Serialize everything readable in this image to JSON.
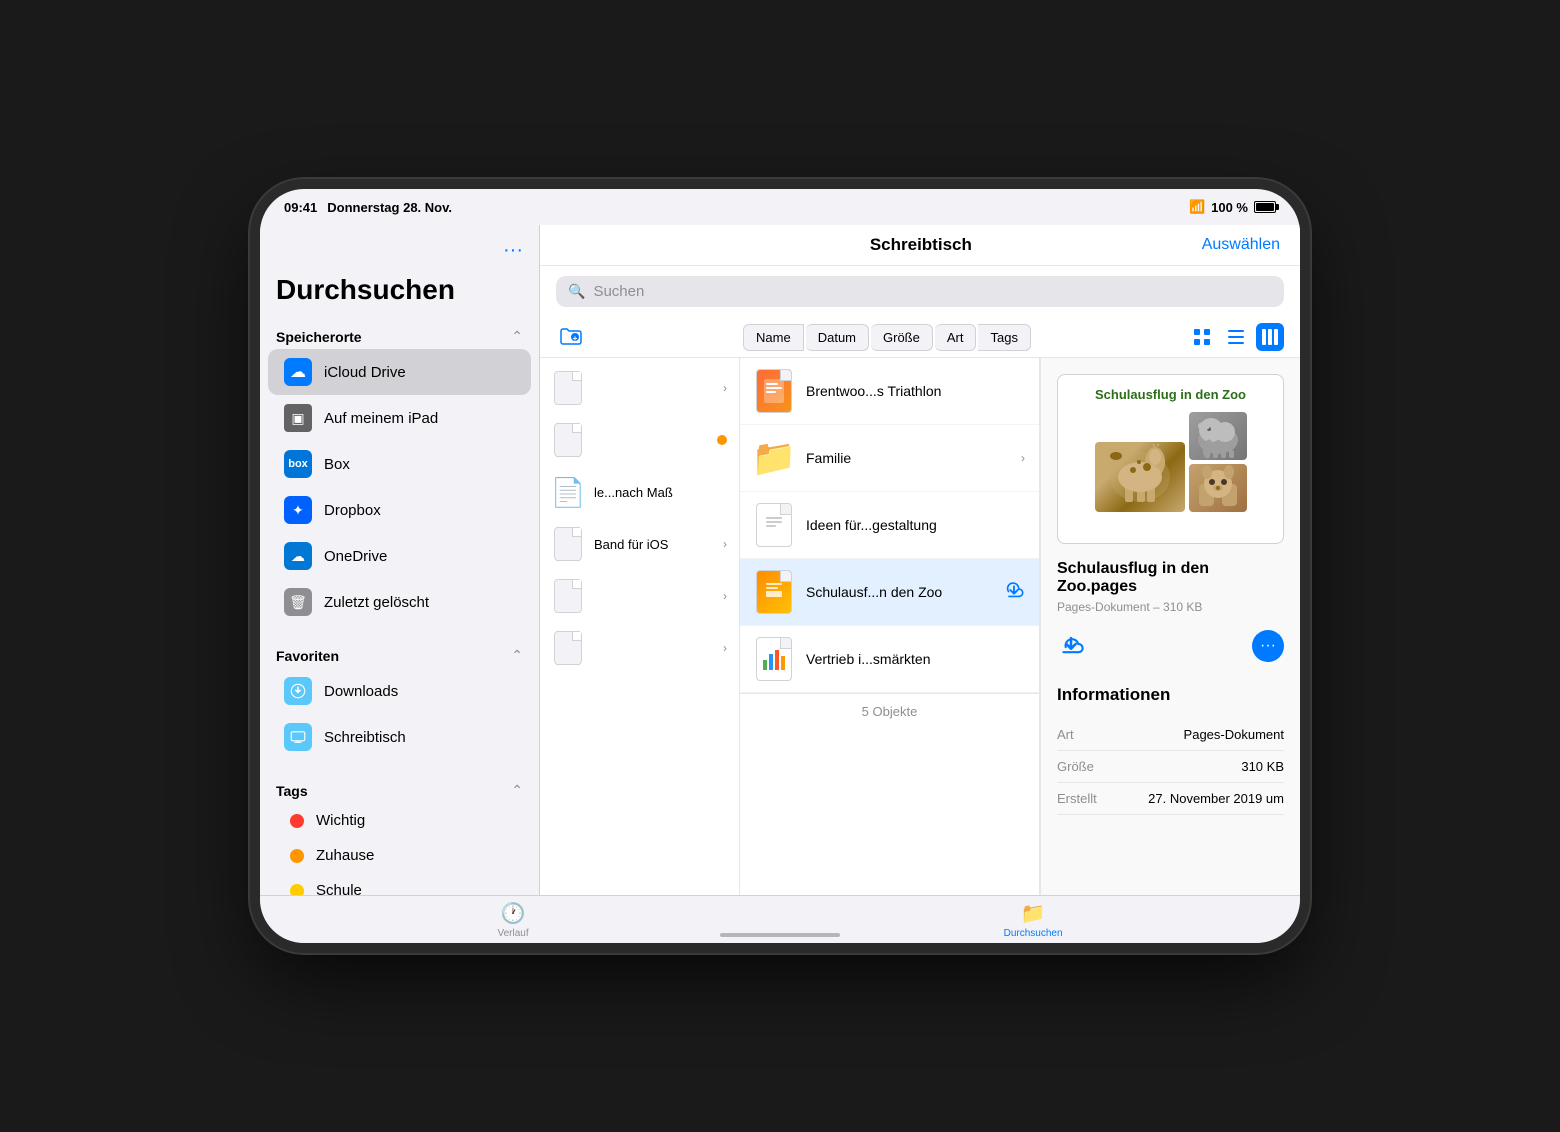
{
  "statusBar": {
    "time": "09:41",
    "date": "Donnerstag 28. Nov.",
    "wifi": "wifi",
    "battery": "100 %"
  },
  "sidebar": {
    "title": "Durchsuchen",
    "moreBtn": "...",
    "sections": {
      "speicherorte": {
        "label": "Speicherorte",
        "items": [
          {
            "id": "icloud",
            "label": "iCloud Drive",
            "active": true
          },
          {
            "id": "ipad",
            "label": "Auf meinem iPad",
            "active": false
          },
          {
            "id": "box",
            "label": "Box",
            "active": false
          },
          {
            "id": "dropbox",
            "label": "Dropbox",
            "active": false
          },
          {
            "id": "onedrive",
            "label": "OneDrive",
            "active": false
          },
          {
            "id": "trash",
            "label": "Zuletzt gelöscht",
            "active": false
          }
        ]
      },
      "favoriten": {
        "label": "Favoriten",
        "items": [
          {
            "id": "downloads",
            "label": "Downloads"
          },
          {
            "id": "desktop",
            "label": "Schreibtisch"
          }
        ]
      },
      "tags": {
        "label": "Tags",
        "items": [
          {
            "id": "wichtig",
            "label": "Wichtig",
            "color": "#ff3b30"
          },
          {
            "id": "zuhause",
            "label": "Zuhause",
            "color": "#ff9500"
          },
          {
            "id": "schule",
            "label": "Schule",
            "color": "#ffcc00"
          }
        ]
      }
    }
  },
  "mainPanel": {
    "title": "Schreibtisch",
    "selectBtn": "Auswählen",
    "searchPlaceholder": "Suchen",
    "toolbar": {
      "sortButtons": [
        "Name",
        "Datum",
        "Größe",
        "Art",
        "Tags"
      ]
    },
    "fileColumn": {
      "items": [
        {
          "id": "col1",
          "hasChevron": true,
          "hasOrangeDot": false
        },
        {
          "id": "col2",
          "hasChevron": true,
          "hasOrangeDot": true
        },
        {
          "id": "col3",
          "label": "le...nach Maß",
          "hasChevron": false
        },
        {
          "id": "col4",
          "label": "Band für iOS",
          "hasChevron": true
        },
        {
          "id": "col5",
          "hasChevron": true
        },
        {
          "id": "col6",
          "hasChevron": true
        }
      ]
    },
    "files": [
      {
        "id": "brentwoo",
        "name": "Brentwoo...s Triathlon",
        "type": "pages",
        "hasChevron": false,
        "hasDownload": false
      },
      {
        "id": "familie",
        "name": "Familie",
        "type": "folder",
        "hasChevron": true,
        "hasDownload": false
      },
      {
        "id": "ideen",
        "name": "Ideen für...gestaltung",
        "type": "page-blank",
        "hasChevron": false,
        "hasDownload": false
      },
      {
        "id": "schulausflug",
        "name": "Schulausf...n den Zoo",
        "type": "pages-doc",
        "selected": true,
        "hasDownload": true
      },
      {
        "id": "vertrieb",
        "name": "Vertrieb i...smärkten",
        "type": "pages-chart",
        "hasChevron": false,
        "hasDownload": false
      }
    ],
    "fileCount": "5 Objekte"
  },
  "preview": {
    "thumbnailTitle": "Schulausflug in den Zoo",
    "fileName": "Schulausflug in den Zoo.pages",
    "fileMeta": "Pages-Dokument – 310 KB",
    "infoTitle": "Informationen",
    "infoRows": [
      {
        "label": "Art",
        "value": "Pages-Dokument"
      },
      {
        "label": "Größe",
        "value": "310 KB"
      },
      {
        "label": "Erstellt",
        "value": "27. November 2019 um"
      }
    ]
  },
  "tabBar": {
    "items": [
      {
        "id": "verlauf",
        "label": "Verlauf",
        "icon": "🕐",
        "active": false
      },
      {
        "id": "durchsuchen",
        "label": "Durchsuchen",
        "icon": "📁",
        "active": true
      }
    ]
  }
}
